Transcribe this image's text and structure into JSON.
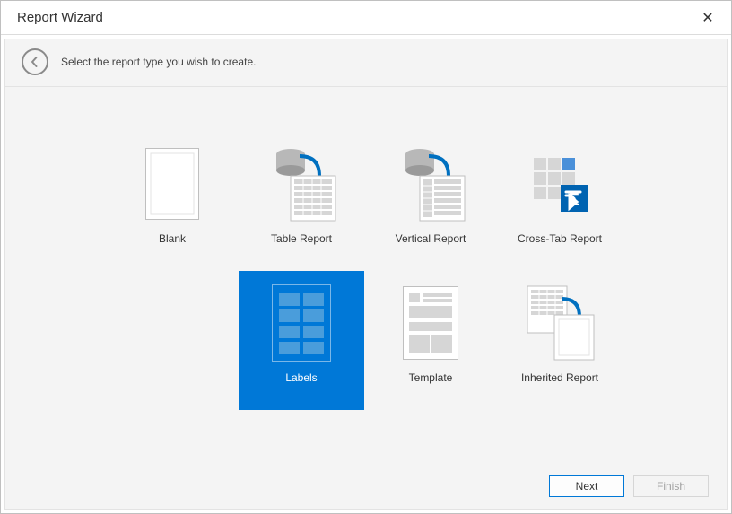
{
  "window": {
    "title": "Report Wizard"
  },
  "instruction": {
    "text": "Select the report type you wish to create."
  },
  "tiles": {
    "blank": "Blank",
    "table": "Table Report",
    "vertical": "Vertical Report",
    "crosstab": "Cross-Tab Report",
    "labels": "Labels",
    "template": "Template",
    "inherited": "Inherited Report"
  },
  "buttons": {
    "next": "Next",
    "finish": "Finish"
  },
  "selected": "labels",
  "colors": {
    "accent": "#0078d7"
  }
}
